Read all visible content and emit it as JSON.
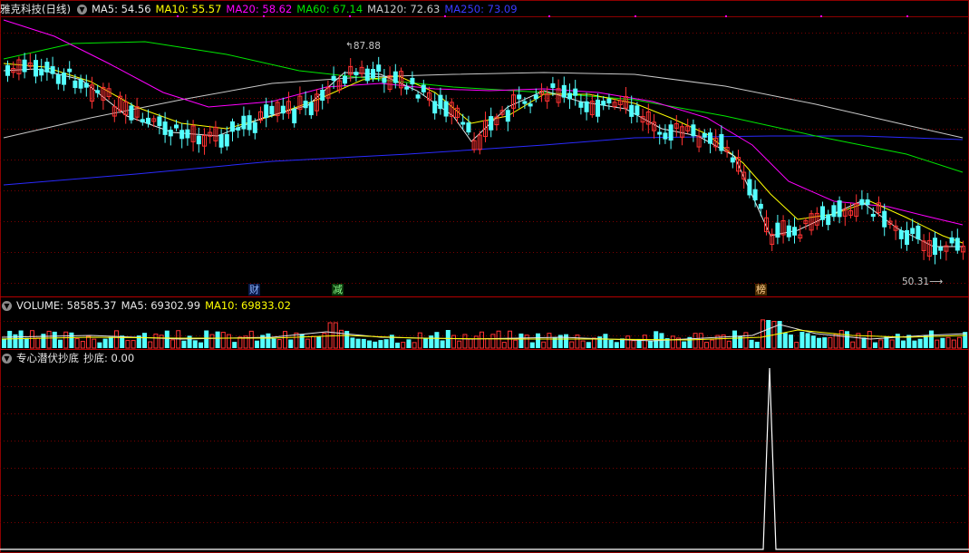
{
  "header": {
    "stock_title": "雅克科技(日线)",
    "ma5": "MA5: 54.56",
    "ma10": "MA10: 55.57",
    "ma20": "MA20: 58.62",
    "ma60": "MA60: 67.14",
    "ma120": "MA120: 72.63",
    "ma250": "MA250: 73.09"
  },
  "volume_header": {
    "volume": "VOLUME: 58585.37",
    "ma5": "MA5: 69302.99",
    "ma10": "MA10: 69833.02"
  },
  "indicator_header": {
    "name": "专心潜伏抄底",
    "value": "抄底: 0.00"
  },
  "price_labels": {
    "high": "87.88",
    "low": "50.31"
  },
  "event_markers": [
    "财",
    "减",
    "榜"
  ],
  "colors": {
    "background": "#000000",
    "up": "#ff3232",
    "down": "#54ffff",
    "ma5": "#e6e6e6",
    "ma10": "#ffff00",
    "ma20": "#ff00ff",
    "ma60": "#00e600",
    "ma120": "#c8c8c8",
    "ma250": "#2a2aff",
    "grid": "#7a0000"
  },
  "icons": [
    "circle-chevron-down-icon"
  ]
}
